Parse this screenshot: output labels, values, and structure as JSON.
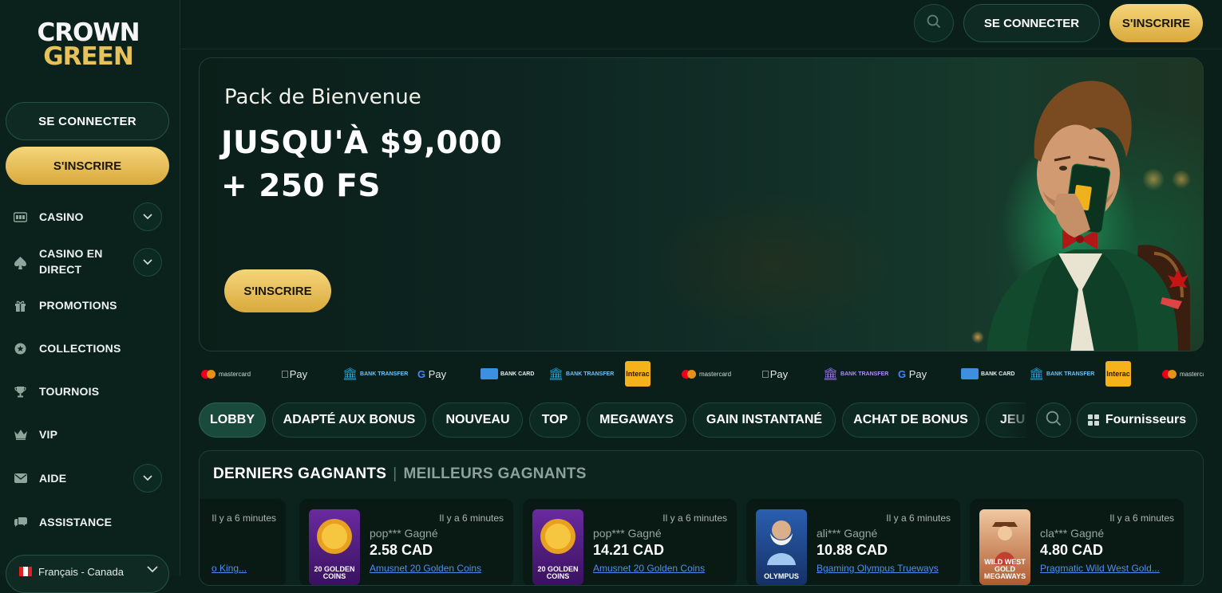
{
  "brand": {
    "line1": "CROWN",
    "line2": "GREEN"
  },
  "sidebar": {
    "login_label": "SE CONNECTER",
    "signup_label": "S'INSCRIRE",
    "items": [
      {
        "label": "CASINO",
        "icon": "slot-machine-icon",
        "expandable": true
      },
      {
        "label": "CASINO EN DIRECT",
        "icon": "spade-icon",
        "expandable": true
      },
      {
        "label": "PROMOTIONS",
        "icon": "gift-icon",
        "expandable": false
      },
      {
        "label": "COLLECTIONS",
        "icon": "star-badge-icon",
        "expandable": false
      },
      {
        "label": "TOURNOIS",
        "icon": "trophy-icon",
        "expandable": false
      },
      {
        "label": "VIP",
        "icon": "crown-icon",
        "expandable": false
      },
      {
        "label": "AIDE",
        "icon": "mail-icon",
        "expandable": true
      },
      {
        "label": "ASSISTANCE",
        "icon": "chat-icon",
        "expandable": false
      }
    ],
    "language": "Français - Canada"
  },
  "topbar": {
    "login_label": "SE CONNECTER",
    "signup_label": "S'INSCRIRE"
  },
  "hero": {
    "subtitle": "Pack de Bienvenue",
    "title_line1": "JUSQU'À $9,000",
    "title_line2": "+ 250 FS",
    "cta_label": "S'INSCRIRE"
  },
  "payments": [
    {
      "name": "mastercard"
    },
    {
      "name": "Pay"
    },
    {
      "name": "BANK TRANSFER"
    },
    {
      "name": "Pay"
    },
    {
      "name": "BANK CARD"
    },
    {
      "name": "BANK TRANSFER"
    },
    {
      "name": "Interac"
    },
    {
      "name": "mastercard"
    },
    {
      "name": "Pay"
    },
    {
      "name": "BANK TRANSFER"
    },
    {
      "name": "Pay"
    },
    {
      "name": "BANK CARD"
    },
    {
      "name": "BANK TRANSFER"
    },
    {
      "name": "Interac"
    },
    {
      "name": "mastercard"
    }
  ],
  "categories": [
    "LOBBY",
    "ADAPTÉ AUX BONUS",
    "NOUVEAU",
    "TOP",
    "MEGAWAYS",
    "GAIN INSTANTANÉ",
    "ACHAT DE BONUS",
    "JEUX"
  ],
  "providers_label": "Fournisseurs",
  "winners": {
    "tab_active": "DERNIERS GAGNANTS",
    "separator": "|",
    "tab_inactive": "MEILLEURS GAGNANTS",
    "cards": [
      {
        "time": "Il y a 6 minutes",
        "user": "",
        "amount": "",
        "game": "o King..."
      },
      {
        "time": "Il y a 6 minutes",
        "user": "pop*** Gagné",
        "amount": "2.58 CAD",
        "game": "Amusnet 20 Golden Coins",
        "thumb_text": "20 GOLDEN COINS"
      },
      {
        "time": "Il y a 6 minutes",
        "user": "pop*** Gagné",
        "amount": "14.21 CAD",
        "game": "Amusnet 20 Golden Coins",
        "thumb_text": "20 GOLDEN COINS"
      },
      {
        "time": "Il y a 6 minutes",
        "user": "ali*** Gagné",
        "amount": "10.88 CAD",
        "game": "Bgaming Olympus Trueways",
        "thumb_text": "OLYMPUS"
      },
      {
        "time": "Il y a 6 minutes",
        "user": "cla*** Gagné",
        "amount": "4.80 CAD",
        "game": "Pragmatic Wild West Gold...",
        "thumb_text": "WILD WEST GOLD MEGAWAYS"
      }
    ]
  },
  "colors": {
    "gold": "#e3b64d",
    "background": "#0a1f19",
    "panel": "#0c231d",
    "link": "#4f8ef0"
  }
}
